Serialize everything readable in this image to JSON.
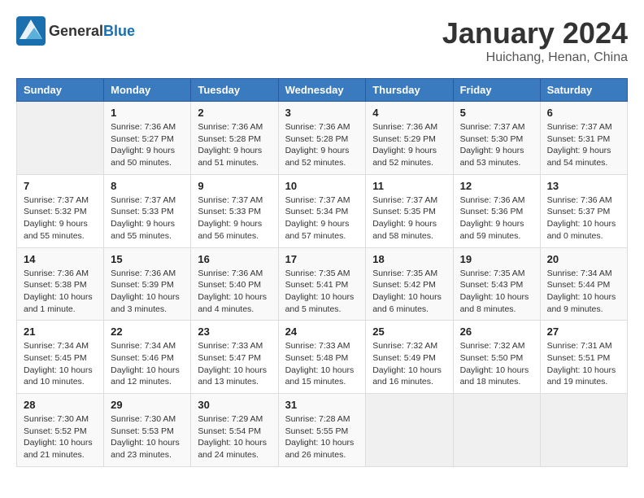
{
  "header": {
    "logo_general": "General",
    "logo_blue": "Blue",
    "title": "January 2024",
    "subtitle": "Huichang, Henan, China"
  },
  "days_of_week": [
    "Sunday",
    "Monday",
    "Tuesday",
    "Wednesday",
    "Thursday",
    "Friday",
    "Saturday"
  ],
  "weeks": [
    [
      {
        "day": "",
        "info": ""
      },
      {
        "day": "1",
        "info": "Sunrise: 7:36 AM\nSunset: 5:27 PM\nDaylight: 9 hours\nand 50 minutes."
      },
      {
        "day": "2",
        "info": "Sunrise: 7:36 AM\nSunset: 5:28 PM\nDaylight: 9 hours\nand 51 minutes."
      },
      {
        "day": "3",
        "info": "Sunrise: 7:36 AM\nSunset: 5:28 PM\nDaylight: 9 hours\nand 52 minutes."
      },
      {
        "day": "4",
        "info": "Sunrise: 7:36 AM\nSunset: 5:29 PM\nDaylight: 9 hours\nand 52 minutes."
      },
      {
        "day": "5",
        "info": "Sunrise: 7:37 AM\nSunset: 5:30 PM\nDaylight: 9 hours\nand 53 minutes."
      },
      {
        "day": "6",
        "info": "Sunrise: 7:37 AM\nSunset: 5:31 PM\nDaylight: 9 hours\nand 54 minutes."
      }
    ],
    [
      {
        "day": "7",
        "info": "Sunrise: 7:37 AM\nSunset: 5:32 PM\nDaylight: 9 hours\nand 55 minutes."
      },
      {
        "day": "8",
        "info": "Sunrise: 7:37 AM\nSunset: 5:33 PM\nDaylight: 9 hours\nand 55 minutes."
      },
      {
        "day": "9",
        "info": "Sunrise: 7:37 AM\nSunset: 5:33 PM\nDaylight: 9 hours\nand 56 minutes."
      },
      {
        "day": "10",
        "info": "Sunrise: 7:37 AM\nSunset: 5:34 PM\nDaylight: 9 hours\nand 57 minutes."
      },
      {
        "day": "11",
        "info": "Sunrise: 7:37 AM\nSunset: 5:35 PM\nDaylight: 9 hours\nand 58 minutes."
      },
      {
        "day": "12",
        "info": "Sunrise: 7:36 AM\nSunset: 5:36 PM\nDaylight: 9 hours\nand 59 minutes."
      },
      {
        "day": "13",
        "info": "Sunrise: 7:36 AM\nSunset: 5:37 PM\nDaylight: 10 hours\nand 0 minutes."
      }
    ],
    [
      {
        "day": "14",
        "info": "Sunrise: 7:36 AM\nSunset: 5:38 PM\nDaylight: 10 hours\nand 1 minute."
      },
      {
        "day": "15",
        "info": "Sunrise: 7:36 AM\nSunset: 5:39 PM\nDaylight: 10 hours\nand 3 minutes."
      },
      {
        "day": "16",
        "info": "Sunrise: 7:36 AM\nSunset: 5:40 PM\nDaylight: 10 hours\nand 4 minutes."
      },
      {
        "day": "17",
        "info": "Sunrise: 7:35 AM\nSunset: 5:41 PM\nDaylight: 10 hours\nand 5 minutes."
      },
      {
        "day": "18",
        "info": "Sunrise: 7:35 AM\nSunset: 5:42 PM\nDaylight: 10 hours\nand 6 minutes."
      },
      {
        "day": "19",
        "info": "Sunrise: 7:35 AM\nSunset: 5:43 PM\nDaylight: 10 hours\nand 8 minutes."
      },
      {
        "day": "20",
        "info": "Sunrise: 7:34 AM\nSunset: 5:44 PM\nDaylight: 10 hours\nand 9 minutes."
      }
    ],
    [
      {
        "day": "21",
        "info": "Sunrise: 7:34 AM\nSunset: 5:45 PM\nDaylight: 10 hours\nand 10 minutes."
      },
      {
        "day": "22",
        "info": "Sunrise: 7:34 AM\nSunset: 5:46 PM\nDaylight: 10 hours\nand 12 minutes."
      },
      {
        "day": "23",
        "info": "Sunrise: 7:33 AM\nSunset: 5:47 PM\nDaylight: 10 hours\nand 13 minutes."
      },
      {
        "day": "24",
        "info": "Sunrise: 7:33 AM\nSunset: 5:48 PM\nDaylight: 10 hours\nand 15 minutes."
      },
      {
        "day": "25",
        "info": "Sunrise: 7:32 AM\nSunset: 5:49 PM\nDaylight: 10 hours\nand 16 minutes."
      },
      {
        "day": "26",
        "info": "Sunrise: 7:32 AM\nSunset: 5:50 PM\nDaylight: 10 hours\nand 18 minutes."
      },
      {
        "day": "27",
        "info": "Sunrise: 7:31 AM\nSunset: 5:51 PM\nDaylight: 10 hours\nand 19 minutes."
      }
    ],
    [
      {
        "day": "28",
        "info": "Sunrise: 7:30 AM\nSunset: 5:52 PM\nDaylight: 10 hours\nand 21 minutes."
      },
      {
        "day": "29",
        "info": "Sunrise: 7:30 AM\nSunset: 5:53 PM\nDaylight: 10 hours\nand 23 minutes."
      },
      {
        "day": "30",
        "info": "Sunrise: 7:29 AM\nSunset: 5:54 PM\nDaylight: 10 hours\nand 24 minutes."
      },
      {
        "day": "31",
        "info": "Sunrise: 7:28 AM\nSunset: 5:55 PM\nDaylight: 10 hours\nand 26 minutes."
      },
      {
        "day": "",
        "info": ""
      },
      {
        "day": "",
        "info": ""
      },
      {
        "day": "",
        "info": ""
      }
    ]
  ]
}
